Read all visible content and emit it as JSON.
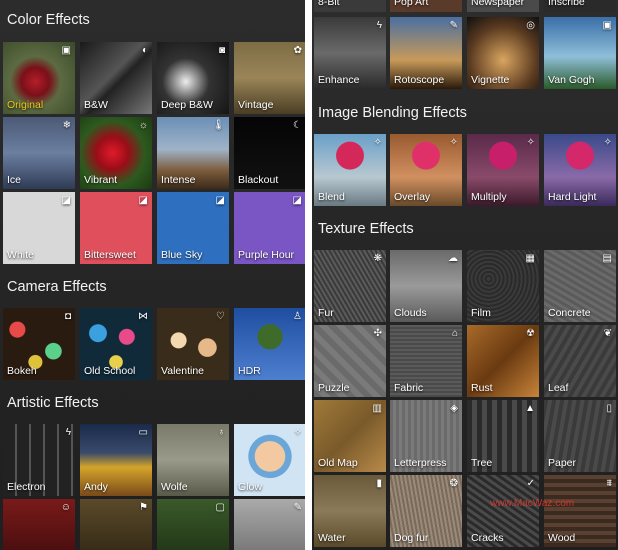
{
  "left": {
    "sections": [
      {
        "title": "Color Effects",
        "tiles": [
          {
            "label": "Original",
            "icon": "image-icon",
            "selected": true
          },
          {
            "label": "B&W",
            "icon": "half-circle-icon"
          },
          {
            "label": "Deep B&W",
            "icon": "glasses-icon"
          },
          {
            "label": "Vintage",
            "icon": "badge-icon"
          },
          {
            "label": "Ice",
            "icon": "snowflake-icon"
          },
          {
            "label": "Vibrant",
            "icon": "sun-icon"
          },
          {
            "label": "Intense",
            "icon": "thermometer-icon"
          },
          {
            "label": "Blackout",
            "icon": "moon-icon"
          },
          {
            "label": "White",
            "icon": "paint-bucket-icon"
          },
          {
            "label": "Bittersweet",
            "icon": "paint-bucket-icon"
          },
          {
            "label": "Blue Sky",
            "icon": "paint-bucket-icon"
          },
          {
            "label": "Purple Hour",
            "icon": "paint-bucket-icon"
          }
        ]
      },
      {
        "title": "Camera Effects",
        "tiles": [
          {
            "label": "Bokeh",
            "icon": "camera-icon"
          },
          {
            "label": "Old School",
            "icon": "bow-icon"
          },
          {
            "label": "Valentine",
            "icon": "heart-icon"
          },
          {
            "label": "HDR",
            "icon": "person-icon"
          }
        ]
      },
      {
        "title": "Artistic Effects",
        "tiles": [
          {
            "label": "Electron",
            "icon": "lightning-icon"
          },
          {
            "label": "Andy",
            "icon": "car-icon"
          },
          {
            "label": "Wolfe",
            "icon": "pin-icon"
          },
          {
            "label": "Glow",
            "icon": "wand-icon"
          },
          {
            "label": "",
            "icon": "smiley-icon"
          },
          {
            "label": "",
            "icon": "runner-icon"
          },
          {
            "label": "",
            "icon": "tv-icon"
          },
          {
            "label": "",
            "icon": "pencil-icon"
          }
        ]
      }
    ]
  },
  "right": {
    "partial_row": [
      {
        "label": "8-Bit",
        "icon": ""
      },
      {
        "label": "Pop Art",
        "icon": ""
      },
      {
        "label": "Newspaper",
        "icon": ""
      },
      {
        "label": "Inscribe",
        "icon": ""
      }
    ],
    "sections": [
      {
        "title": "",
        "tiles": [
          {
            "label": "Enhance",
            "icon": "lightning-icon"
          },
          {
            "label": "Rotoscope",
            "icon": "pencil-icon"
          },
          {
            "label": "Vignette",
            "icon": "target-icon"
          },
          {
            "label": "Van Gogh",
            "icon": "frame-icon"
          }
        ]
      },
      {
        "title": "Image Blending Effects",
        "tiles": [
          {
            "label": "Blend",
            "icon": "wand-icon"
          },
          {
            "label": "Overlay",
            "icon": "wand-icon"
          },
          {
            "label": "Multiply",
            "icon": "wand-icon"
          },
          {
            "label": "Hard Light",
            "icon": "wand-icon"
          }
        ]
      },
      {
        "title": "Texture Effects",
        "tiles": [
          {
            "label": "Fur",
            "icon": "paw-icon"
          },
          {
            "label": "Clouds",
            "icon": "cloud-icon"
          },
          {
            "label": "Film",
            "icon": "film-icon"
          },
          {
            "label": "Concrete",
            "icon": "toolbox-icon"
          },
          {
            "label": "Puzzle",
            "icon": "puzzle-icon"
          },
          {
            "label": "Fabric",
            "icon": "iron-icon"
          },
          {
            "label": "Rust",
            "icon": "radiation-icon"
          },
          {
            "label": "Leaf",
            "icon": "leaf-icon"
          },
          {
            "label": "Old Map",
            "icon": "map-icon"
          },
          {
            "label": "Letterpress",
            "icon": "stamp-icon"
          },
          {
            "label": "Tree",
            "icon": "tree-icon"
          },
          {
            "label": "Paper",
            "icon": "document-icon"
          },
          {
            "label": "Water",
            "icon": "bottle-icon"
          },
          {
            "label": "Dog fur",
            "icon": "dog-icon"
          },
          {
            "label": "Cracks",
            "icon": "check-icon"
          },
          {
            "label": "Wood",
            "icon": "fence-icon"
          }
        ]
      }
    ]
  },
  "watermark": "www.MacWaz.com",
  "colors": {
    "panel_bg": "#262626",
    "selected_label": "#f0c419",
    "white_tile": "#d8d8d8",
    "bittersweet_tile": "#e0505c",
    "blue_sky_tile": "#2e6fbf",
    "purple_hour_tile": "#7a55c4",
    "watermark": "#e53a2f"
  }
}
